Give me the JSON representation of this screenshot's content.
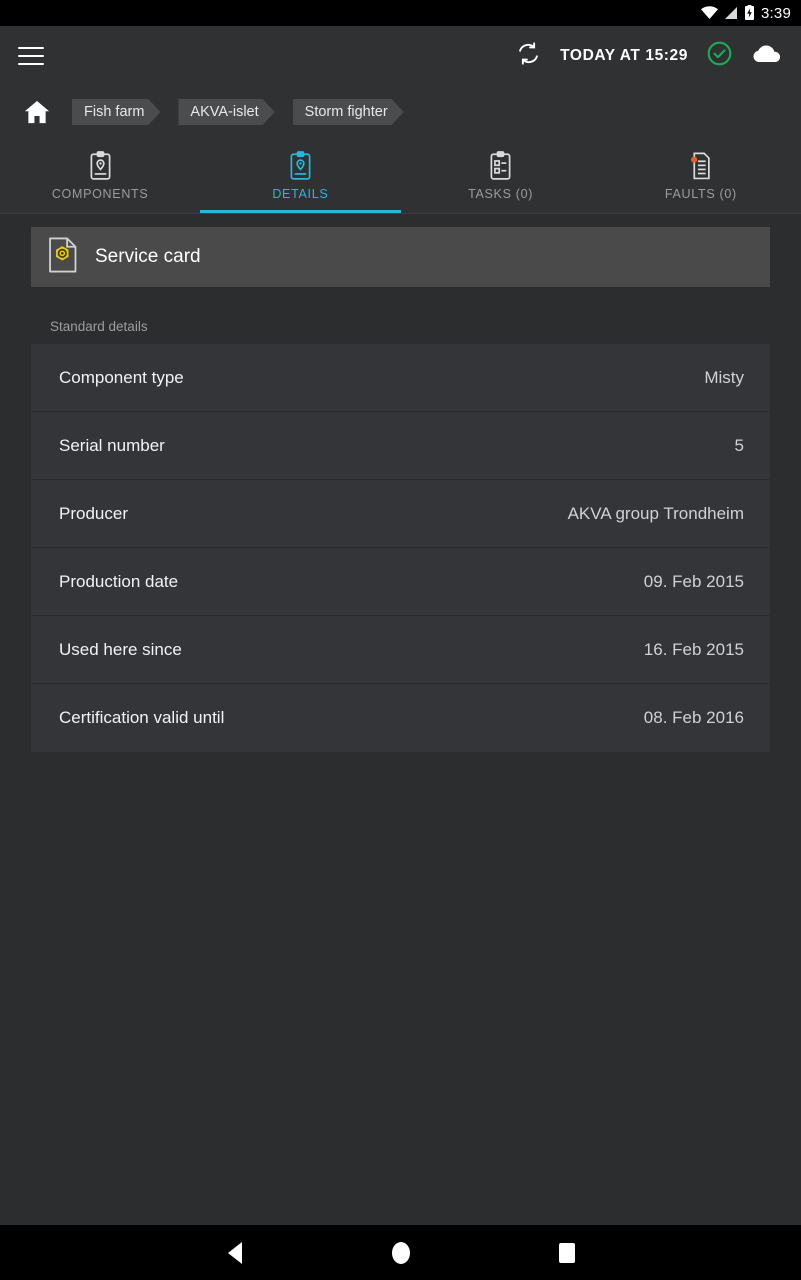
{
  "statusbar": {
    "time": "3:39",
    "icons": [
      "wifi-icon",
      "cellular-signal-icon",
      "battery-charging-icon"
    ]
  },
  "appbar": {
    "menu_icon": "hamburger-menu-icon",
    "sync_icon": "sync-icon",
    "sync_time": "TODAY AT 15:29",
    "status_icon": "check-circle-icon",
    "status_color": "#1faa55",
    "cloud_icon": "cloud-icon"
  },
  "breadcrumb": {
    "home_icon": "home-icon",
    "items": [
      {
        "label": "Fish farm"
      },
      {
        "label": "AKVA-islet"
      },
      {
        "label": "Storm fighter"
      }
    ]
  },
  "tabs": {
    "accent_color": "#29b6dd",
    "items": [
      {
        "label": "COMPONENTS",
        "icon": "clipboard-pin-icon",
        "active": false
      },
      {
        "label": "DETAILS",
        "icon": "clipboard-pin-icon",
        "active": true
      },
      {
        "label": "TASKS (0)",
        "icon": "clipboard-checklist-icon",
        "active": false
      },
      {
        "label": "FAULTS (0)",
        "icon": "document-alert-icon",
        "active": false
      }
    ]
  },
  "main": {
    "service_card": {
      "label": "Service card",
      "icon": "document-gear-icon",
      "icon_color": "#e8c81e"
    },
    "section_label": "Standard details",
    "details": [
      {
        "key": "Component type",
        "value": "Misty"
      },
      {
        "key": "Serial number",
        "value": "5"
      },
      {
        "key": "Producer",
        "value": "AKVA group Trondheim"
      },
      {
        "key": "Production date",
        "value": "09. Feb 2015"
      },
      {
        "key": "Used here since",
        "value": "16. Feb 2015"
      },
      {
        "key": "Certification valid until",
        "value": "08. Feb 2016"
      }
    ]
  },
  "navbar": {
    "back": "back-nav-icon",
    "home": "home-nav-icon",
    "recents": "recents-nav-icon"
  }
}
